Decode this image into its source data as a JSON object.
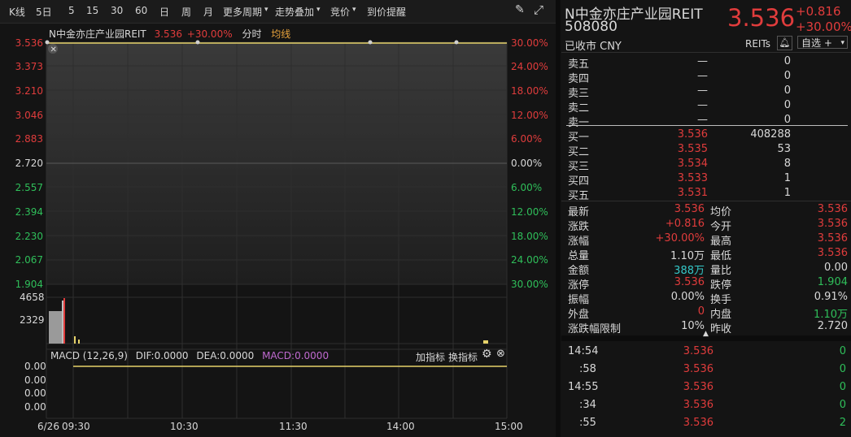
{
  "toolbar": {
    "kline": "K线",
    "period5d": "5日",
    "p5": "5",
    "p15": "15",
    "p30": "30",
    "p60": "60",
    "day": "日",
    "week": "周",
    "month": "月",
    "more": "更多周期",
    "overlay": "走势叠加",
    "bid": "竞价",
    "alert": "到价提醒"
  },
  "chart": {
    "name": "N中金亦庄产业园REIT",
    "price": "3.536",
    "pct": "+30.00%",
    "mode": "分时",
    "avg": "均线",
    "left_ticks": [
      "3.536",
      "3.373",
      "3.210",
      "3.046",
      "2.883",
      "2.720",
      "2.557",
      "2.394",
      "2.230",
      "2.067",
      "1.904"
    ],
    "right_ticks": [
      "30.00%",
      "24.00%",
      "18.00%",
      "12.00%",
      "6.00%",
      "0.00%",
      "6.00%",
      "12.00%",
      "18.00%",
      "24.00%",
      "30.00%"
    ],
    "vol_ticks": [
      "4658",
      "2329"
    ],
    "macd_label": "MACD (12,26,9)",
    "dif": "DIF:0.0000",
    "dea": "DEA:0.0000",
    "macd": "MACD:0.0000",
    "add_ind": "加指标",
    "swap_ind": "换指标",
    "macd_ticks": [
      "0.00",
      "0.00",
      "0.00",
      "0.00"
    ],
    "date": "6/26",
    "time_ticks": [
      "09:30",
      "10:30",
      "11:30",
      "14:00",
      "15:00"
    ],
    "colors": {
      "up": "#e03c3c",
      "down": "#2fbf5a",
      "line": "#e6d26a"
    }
  },
  "quote": {
    "name": "N中金亦庄产业园REIT",
    "code": "508080",
    "price": "3.536",
    "change": "+0.816",
    "change_pct": "+30.00%",
    "status": "已收市 CNY",
    "type": "REITs",
    "watch": "自选 +"
  },
  "orderbook": {
    "asks": [
      {
        "label": "卖五",
        "price": "—",
        "vol": "0"
      },
      {
        "label": "卖四",
        "price": "—",
        "vol": "0"
      },
      {
        "label": "卖三",
        "price": "—",
        "vol": "0"
      },
      {
        "label": "卖二",
        "price": "—",
        "vol": "0"
      },
      {
        "label": "卖一",
        "price": "—",
        "vol": "0"
      }
    ],
    "bids": [
      {
        "label": "买一",
        "price": "3.536",
        "vol": "408288"
      },
      {
        "label": "买二",
        "price": "3.535",
        "vol": "53"
      },
      {
        "label": "买三",
        "price": "3.534",
        "vol": "8"
      },
      {
        "label": "买四",
        "price": "3.533",
        "vol": "1"
      },
      {
        "label": "买五",
        "price": "3.531",
        "vol": "1"
      }
    ]
  },
  "stats": [
    {
      "l1": "最新",
      "v1": "3.536",
      "l2": "均价",
      "v2": "3.536"
    },
    {
      "l1": "涨跌",
      "v1": "+0.816",
      "l2": "今开",
      "v2": "3.536"
    },
    {
      "l1": "涨幅",
      "v1": "+30.00%",
      "l2": "最高",
      "v2": "3.536"
    },
    {
      "l1": "总量",
      "v1": "1.10万",
      "l2": "最低",
      "v2": "3.536"
    },
    {
      "l1": "金额",
      "v1": "388万",
      "l2": "量比",
      "v2": "0.00"
    },
    {
      "l1": "涨停",
      "v1": "3.536",
      "l2": "跌停",
      "v2": "1.904"
    },
    {
      "l1": "振幅",
      "v1": "0.00%",
      "l2": "换手",
      "v2": "0.91%"
    },
    {
      "l1": "外盘",
      "v1": "0",
      "l2": "内盘",
      "v2": "1.10万"
    },
    {
      "l1": "涨跌幅限制",
      "v1": "10%",
      "l2": "昨收",
      "v2": "2.720"
    }
  ],
  "ticks": [
    {
      "time": "14:54",
      "price": "3.536",
      "vol": "0"
    },
    {
      "time": ":58",
      "price": "3.536",
      "vol": "0"
    },
    {
      "time": "14:55",
      "price": "3.536",
      "vol": "0"
    },
    {
      "time": ":34",
      "price": "3.536",
      "vol": "0"
    },
    {
      "time": ":55",
      "price": "3.536",
      "vol": "2"
    }
  ]
}
